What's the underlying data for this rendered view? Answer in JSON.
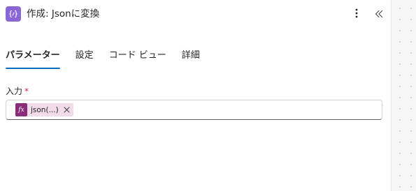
{
  "header": {
    "title": "作成: Jsonに変換",
    "action_icon": "code-braces-icon",
    "more_icon": "more-vertical-icon",
    "collapse_icon": "double-chevron-left-icon"
  },
  "tabs": [
    {
      "label": "パラメーター",
      "active": true
    },
    {
      "label": "設定",
      "active": false
    },
    {
      "label": "コード ビュー",
      "active": false
    },
    {
      "label": "詳細",
      "active": false
    }
  ],
  "field": {
    "label": "入力",
    "required_mark": "*",
    "token": {
      "icon_text": "fx",
      "text": "json(...)",
      "remove_icon": "close-icon"
    }
  },
  "colors": {
    "action_icon_bg": "#8a67d6",
    "tab_underline": "#0f6cbd",
    "token_bg": "#f2dcec",
    "token_icon_bg": "#8a2c78",
    "required": "#c4314b"
  }
}
